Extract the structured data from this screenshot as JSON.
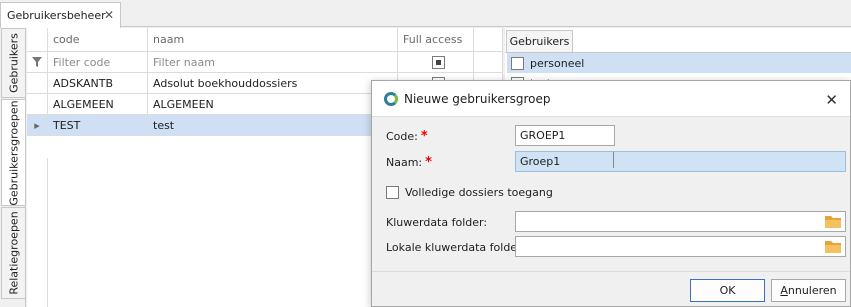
{
  "doc_tab": {
    "label": "Gebruikersbeheer",
    "close": "✕"
  },
  "side_tabs": [
    "Gebruikers",
    "Gebruikersgroepen",
    "Relatiegroepen"
  ],
  "grid": {
    "columns": {
      "code": "code",
      "naam": "naam",
      "full": "Full access"
    },
    "filter": {
      "code": "Filter code",
      "naam": "Filter naam"
    },
    "rows": [
      {
        "code": "ADSKANTB",
        "naam": "Adsolut boekhouddossiers"
      },
      {
        "code": "ALGEMEEN",
        "naam": "ALGEMEEN"
      },
      {
        "code": "TEST",
        "naam": "test",
        "indicator": "▸"
      }
    ]
  },
  "right_panel": {
    "tab": "Gebruikers",
    "items": [
      "personeel",
      "test"
    ]
  },
  "dialog": {
    "title": "Nieuwe gebruikersgroep",
    "close": "✕",
    "code_label": "Code:",
    "code_value": "GROEP1",
    "naam_label": "Naam:",
    "naam_value": "Groep1",
    "required_mark": "*",
    "checkbox_label": "Volledige dossiers toegang",
    "kluwer_label": "Kluwerdata folder:",
    "lokale_label": "Lokale kluwerdata folder:",
    "ok_label": "OK",
    "cancel_prefix": "A",
    "cancel_rest": "nnuleren"
  },
  "colors": {
    "selection": "#cfe0f5",
    "required": "#e00000",
    "folder": "#e8a33c"
  }
}
